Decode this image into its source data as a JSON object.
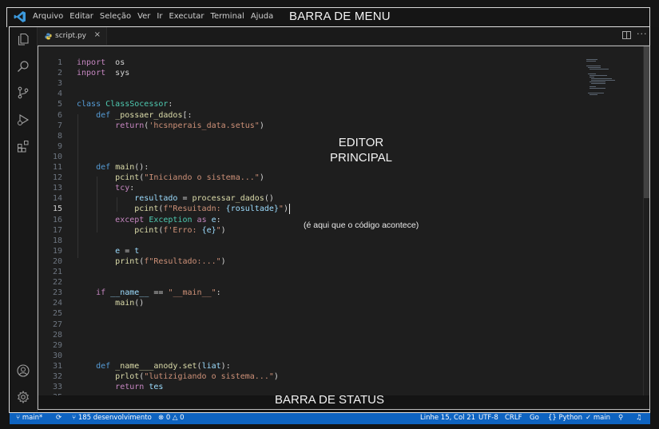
{
  "menubar": {
    "items": [
      "Arquivo",
      "Editar",
      "Seleção",
      "Ver",
      "Ir",
      "Executar",
      "Terminal",
      "Ajuda"
    ],
    "callout": "BARRA DE MENU"
  },
  "tab": {
    "label": "script.py",
    "close": "×"
  },
  "editor": {
    "callout_line1": "EDITOR",
    "callout_line2": "PRINCIPAL",
    "callout_sub": "(é aqui que o código acontece)",
    "active_line": 15
  },
  "code_lines": [
    {
      "n": "1",
      "t": [
        [
          "k",
          "inport"
        ],
        [
          "",
          "  "
        ],
        [
          "",
          "os"
        ]
      ]
    },
    {
      "n": "2",
      "t": [
        [
          "k",
          "inport"
        ],
        [
          "",
          "  "
        ],
        [
          "",
          "sys"
        ]
      ]
    },
    {
      "n": "3",
      "t": []
    },
    {
      "n": "4",
      "t": []
    },
    {
      "n": "5",
      "t": [
        [
          "kb",
          "class"
        ],
        [
          "",
          " "
        ],
        [
          "cls",
          "ClassSocessor"
        ],
        [
          "",
          ":"
        ]
      ]
    },
    {
      "n": "6",
      "t": [
        [
          "",
          "    "
        ],
        [
          "kb",
          "def"
        ],
        [
          "",
          " "
        ],
        [
          "fn",
          "_possaer_dados"
        ],
        [
          "",
          "[:"
        ]
      ]
    },
    {
      "n": "7",
      "t": [
        [
          "",
          "        "
        ],
        [
          "k",
          "return"
        ],
        [
          "",
          "("
        ],
        [
          "s",
          "'hcsnperais_data.setus\""
        ],
        [
          "",
          ")"
        ]
      ]
    },
    {
      "n": "8",
      "t": []
    },
    {
      "n": "9",
      "t": []
    },
    {
      "n": "10",
      "t": []
    },
    {
      "n": "11",
      "t": [
        [
          "",
          "    "
        ],
        [
          "kb",
          "def"
        ],
        [
          "",
          " "
        ],
        [
          "fn",
          "main"
        ],
        [
          "",
          "():"
        ]
      ]
    },
    {
      "n": "12",
      "t": [
        [
          "",
          "        "
        ],
        [
          "fn",
          "pcint"
        ],
        [
          "",
          "("
        ],
        [
          "s",
          "\"Iniciando o sistema...\""
        ],
        [
          "",
          ")"
        ]
      ]
    },
    {
      "n": "13",
      "t": [
        [
          "",
          "        "
        ],
        [
          "k",
          "tcy"
        ],
        [
          "",
          ":"
        ]
      ]
    },
    {
      "n": "14",
      "t": [
        [
          "",
          "            "
        ],
        [
          "v",
          "resultado"
        ],
        [
          "",
          " = "
        ],
        [
          "fn",
          "processar_dados"
        ],
        [
          "",
          "()"
        ]
      ]
    },
    {
      "n": "15",
      "t": [
        [
          "",
          "            "
        ],
        [
          "fn",
          "pcint"
        ],
        [
          "",
          "("
        ],
        [
          "s",
          "f\"Resuitadn: "
        ],
        [
          "v",
          "{rosultade}"
        ],
        [
          "s",
          "\""
        ],
        [
          "",
          ")"
        ]
      ]
    },
    {
      "n": "16",
      "t": [
        [
          "",
          "        "
        ],
        [
          "k",
          "except"
        ],
        [
          "",
          " "
        ],
        [
          "cls",
          "Exception"
        ],
        [
          "",
          " "
        ],
        [
          "k",
          "as"
        ],
        [
          "",
          " "
        ],
        [
          "v",
          "e"
        ],
        [
          "",
          ":"
        ]
      ]
    },
    {
      "n": "17",
      "t": [
        [
          "",
          "            "
        ],
        [
          "fn",
          "pcint"
        ],
        [
          "",
          "("
        ],
        [
          "s",
          "f'Erro: "
        ],
        [
          "v",
          "{e}"
        ],
        [
          "s",
          "\""
        ],
        [
          "",
          ")"
        ]
      ]
    },
    {
      "n": "18",
      "t": []
    },
    {
      "n": "19",
      "t": [
        [
          "",
          "        "
        ],
        [
          "v",
          "e"
        ],
        [
          "",
          " = "
        ],
        [
          "v",
          "t"
        ]
      ]
    },
    {
      "n": "20",
      "t": [
        [
          "",
          "        "
        ],
        [
          "fn",
          "print"
        ],
        [
          "",
          "("
        ],
        [
          "s",
          "f\"Resultado:...\""
        ],
        [
          "",
          ")"
        ]
      ]
    },
    {
      "n": "21",
      "t": []
    },
    {
      "n": "22",
      "t": []
    },
    {
      "n": "23",
      "t": [
        [
          "",
          "    "
        ],
        [
          "k",
          "if"
        ],
        [
          "",
          " "
        ],
        [
          "v",
          "__name__"
        ],
        [
          "",
          " == "
        ],
        [
          "s",
          "\"__main__\""
        ],
        [
          "",
          ":"
        ]
      ]
    },
    {
      "n": "24",
      "t": [
        [
          "",
          "        "
        ],
        [
          "fn",
          "main"
        ],
        [
          "",
          "()"
        ]
      ]
    },
    {
      "n": "25",
      "t": []
    },
    {
      "n": "27",
      "t": []
    },
    {
      "n": "28",
      "t": []
    },
    {
      "n": "29",
      "t": []
    },
    {
      "n": "30",
      "t": []
    },
    {
      "n": "31",
      "t": [
        [
          "",
          "    "
        ],
        [
          "kb",
          "def"
        ],
        [
          "",
          " "
        ],
        [
          "fn",
          "_name___anody.set"
        ],
        [
          "",
          "("
        ],
        [
          "v",
          "liat"
        ],
        [
          "",
          "):"
        ]
      ]
    },
    {
      "n": "32",
      "t": [
        [
          "",
          "        "
        ],
        [
          "fn",
          "prlot"
        ],
        [
          "",
          "("
        ],
        [
          "s",
          "\"lutizigiando o sistema...\""
        ],
        [
          "",
          ")"
        ]
      ]
    },
    {
      "n": "33",
      "t": [
        [
          "",
          "        "
        ],
        [
          "k",
          "return"
        ],
        [
          "",
          " "
        ],
        [
          "v",
          "tes"
        ]
      ]
    },
    {
      "n": "35",
      "t": []
    }
  ],
  "statusbar": {
    "branch": "main*",
    "sync": "185 desenvolvimento",
    "problems": "⊗ 0  △ 0",
    "position": "Linhe 15, Col 21",
    "encoding": "UTF-8",
    "eol": "CRLF",
    "golive": "Go",
    "language": "Python",
    "check": "✓ main",
    "callout": "BARRA DE STATUS"
  },
  "colors": {
    "status_bg": "#0e63c0",
    "editor_bg": "#1e1e1e",
    "keyword": "#c586c0",
    "function": "#dcdcaa",
    "string": "#ce9178"
  }
}
